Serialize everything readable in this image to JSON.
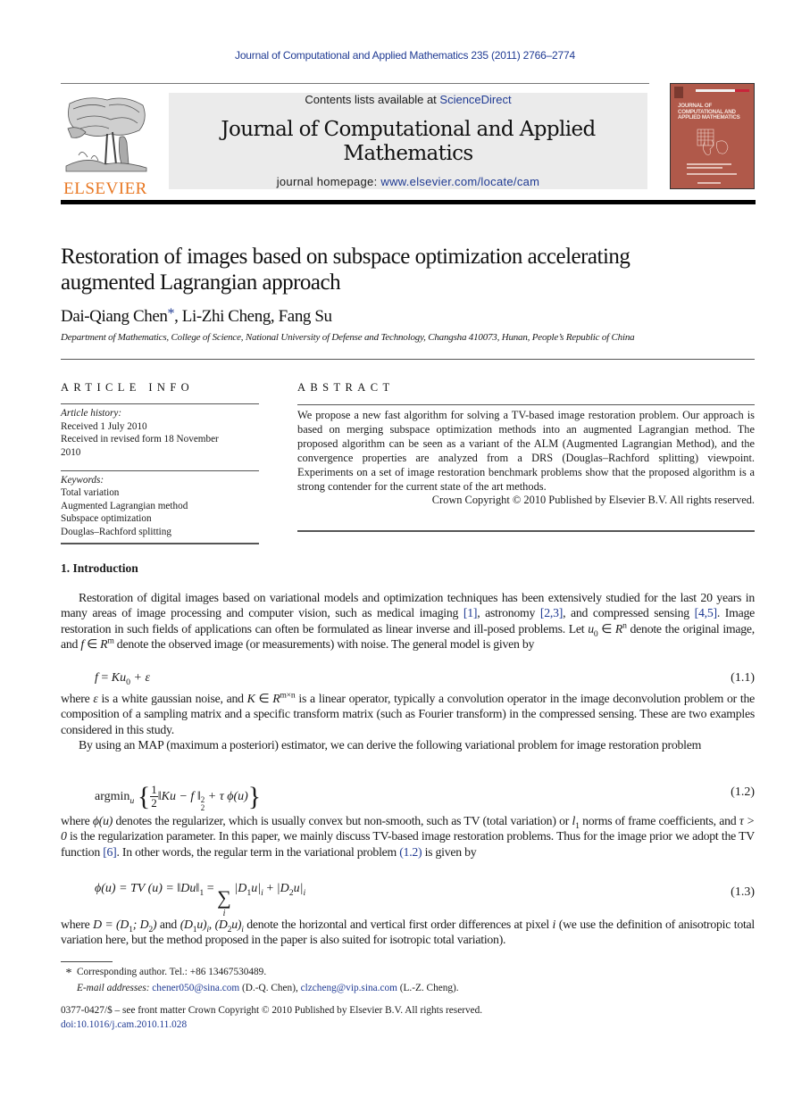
{
  "running_head": "Journal of Computational and Applied Mathematics 235 (2011) 2766–2774",
  "publisher": {
    "name": "ELSEVIER",
    "logo_icon": "elsevier-tree-icon",
    "brand_color": "#e87722",
    "link_color": "#1f3a93"
  },
  "banner": {
    "contents_prefix": "Contents lists available at ",
    "contents_link": "ScienceDirect",
    "journal_title_line1": "Journal of Computational and Applied",
    "journal_title_line2": "Mathematics",
    "homepage_prefix": "journal homepage: ",
    "homepage_link": "www.elsevier.com/locate/cam"
  },
  "cover": {
    "title_lines": [
      "JOURNAL OF",
      "COMPUTATIONAL AND",
      "APPLIED MATHEMATICS"
    ],
    "color": "#b0594a"
  },
  "article": {
    "title_line1": "Restoration of images based on subspace optimization accelerating",
    "title_line2": "augmented Lagrangian approach",
    "authors": [
      {
        "name": "Dai-Qiang Chen",
        "mark": "*"
      },
      {
        "name": "Li-Zhi Cheng",
        "mark": ""
      },
      {
        "name": "Fang Su",
        "mark": ""
      }
    ],
    "author_sep": ", ",
    "affiliation": "Department of Mathematics, College of Science, National University of Defense and Technology, Changsha 410073, Hunan, People’s Republic of China"
  },
  "article_info": {
    "heading": "ARTICLE INFO",
    "history_label": "Article history:",
    "history": [
      "Received 1 July 2010",
      "Received in revised form 18 November",
      "2010"
    ],
    "keywords_label": "Keywords:",
    "keywords": [
      "Total variation",
      "Augmented Lagrangian method",
      "Subspace optimization",
      "Douglas–Rachford splitting"
    ]
  },
  "abstract": {
    "heading": "ABSTRACT",
    "text": "We propose a new fast algorithm for solving a TV-based image restoration problem. Our approach is based on merging subspace optimization methods into an augmented Lagrangian method. The proposed algorithm can be seen as a variant of the ALM (Augmented Lagrangian Method), and the convergence properties are analyzed from a DRS (Douglas–Rachford splitting) viewpoint. Experiments on a set of image restoration benchmark problems show that the proposed algorithm is a strong contender for the current state of the art methods.",
    "copyright": "Crown Copyright © 2010 Published by Elsevier B.V. All rights reserved."
  },
  "introduction": {
    "heading": "1.  Introduction",
    "p1": {
      "a": "Restoration of digital images based on variational models and optimization techniques has been extensively studied for the last 20 years in many areas of image processing and computer vision, such as medical imaging ",
      "ref1": "[1]",
      "b": ", astronomy ",
      "ref2": "[2,3]",
      "c": ", and compressed sensing ",
      "ref3": "[4,5]",
      "d": ". Image restoration in such fields of applications can often be formulated as linear inverse and ill-posed problems. Let ",
      "u0": "u",
      "u0_sub": "0",
      "e": " ∈ ",
      "Rn": "R",
      "Rn_sup": "n",
      "f1": " denote the original image, and ",
      "fvar": "f",
      "g": " ∈ ",
      "Rm": "R",
      "Rm_sup": "m",
      "h": " denote the observed image (or measurements) with noise. The general model is given by"
    },
    "eq1": {
      "lhs": "f",
      "rel": " = ",
      "rhs_a": "Ku",
      "rhs_sub": "0",
      "rhs_b": " + ε",
      "number": "(1.1)"
    },
    "p2": {
      "a": "where ",
      "eps": "ε",
      "b": " is a white gaussian noise, and ",
      "K": "K",
      "c": " ∈ ",
      "R": "R",
      "R_sup": "m×n",
      "d": " is a linear operator, typically a convolution operator in the image deconvolution problem or the composition of a sampling matrix and a specific transform matrix (such as Fourier transform) in the compressed sensing. These are two examples considered in this study."
    },
    "p3": "By using an MAP (maximum a posteriori) estimator, we can derive the following variational problem for image restoration problem",
    "eq2": {
      "argmin": "argmin",
      "argmin_sub": "u",
      "frac_num": "1",
      "frac_den": "2",
      "norm": "‖Ku − f ‖",
      "norm_sub": "2",
      "norm_sup": "2",
      "tail": " + τ ϕ(u)",
      "number": "(1.2)"
    },
    "p4": {
      "a": "where ",
      "phi": "ϕ(u)",
      "b": " denotes the regularizer, which is usually convex but non-smooth, such as TV (total variation) or ",
      "l": "l",
      "l_sub": "1",
      "c": " norms of frame coefficients, and ",
      "tau": "τ > 0",
      "d": " is the regularization parameter. In this paper, we mainly discuss TV-based image restoration problems. Thus for the image prior we adopt the TV function ",
      "ref": "[6]",
      "e": ". In other words, the regular term in the variational problem ",
      "eqref": "(1.2)",
      "f": " is given by"
    },
    "eq3": {
      "lhs": "ϕ(u) = TV (u) = ‖Du‖",
      "lhs_sub": "1",
      "rel": " = ",
      "sum": "∑",
      "sum_sub": "i",
      "t1": "|D",
      "t1_sub": "1",
      "t1b": "u|",
      "t1_i": "i",
      "plus": " + ",
      "t2": "|D",
      "t2_sub": "2",
      "t2b": "u|",
      "t2_i": "i",
      "number": "(1.3)"
    },
    "p5": {
      "a": "where ",
      "D": "D = (D",
      "D1": "1",
      "Dmid": "; D",
      "D2": "2",
      "Dend": ")",
      "b": " and ",
      "t1": "(D",
      "t1s": "1",
      "t1b": "u)",
      "t1i": "i",
      "comma": ", ",
      "t2": "(D",
      "t2s": "2",
      "t2b": "u)",
      "t2i": "i",
      "c": " denote the horizontal and vertical first order differences at pixel ",
      "i": "i",
      "d": " (we use the definition of anisotropic total variation here, but the method proposed in the paper is also suited for isotropic total variation)."
    }
  },
  "footnotes": {
    "star": "*",
    "corresponding": "Corresponding author. Tel.: +86 13467530489.",
    "email_label": "E-mail addresses: ",
    "email1": "chener050@sina.com",
    "email1_who": " (D.-Q. Chen), ",
    "email2": "clzcheng@vip.sina.com",
    "email2_who": " (L.-Z. Cheng)."
  },
  "front_matter": {
    "issn_line": "0377-0427/$ – see front matter Crown Copyright © 2010 Published by Elsevier B.V. All rights reserved.",
    "doi": "doi:10.1016/j.cam.2010.11.028"
  }
}
